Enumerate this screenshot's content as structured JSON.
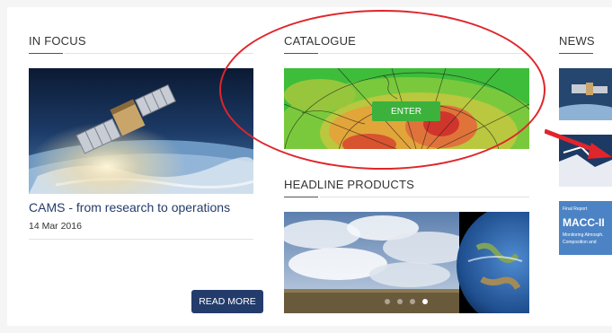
{
  "in_focus": {
    "heading": "IN FOCUS",
    "item_title": "CAMS - from research to operations",
    "item_date": "14 Mar 2016",
    "read_more_label": "READ MORE",
    "image_icon": "satellite-over-earth"
  },
  "catalogue": {
    "heading": "CATALOGUE",
    "enter_label": "ENTER",
    "map_icon": "polar-atmospheric-map",
    "highlight_color": "#e0252b"
  },
  "headline_products": {
    "heading": "HEADLINE PRODUCTS",
    "image_icon": "sky-and-globe-composite",
    "slides": 4,
    "active_slide": 4
  },
  "news": {
    "heading": "NEWS",
    "thumb3_line1": "Final Report",
    "thumb3_line2": "MACC-II",
    "thumb3_line3": "Monitoring Atmosph.",
    "thumb3_line4": "Composition and"
  },
  "colors": {
    "brand_navy": "#243c6b",
    "enter_green": "#3cb13c",
    "annotation_red": "#e0252b"
  }
}
